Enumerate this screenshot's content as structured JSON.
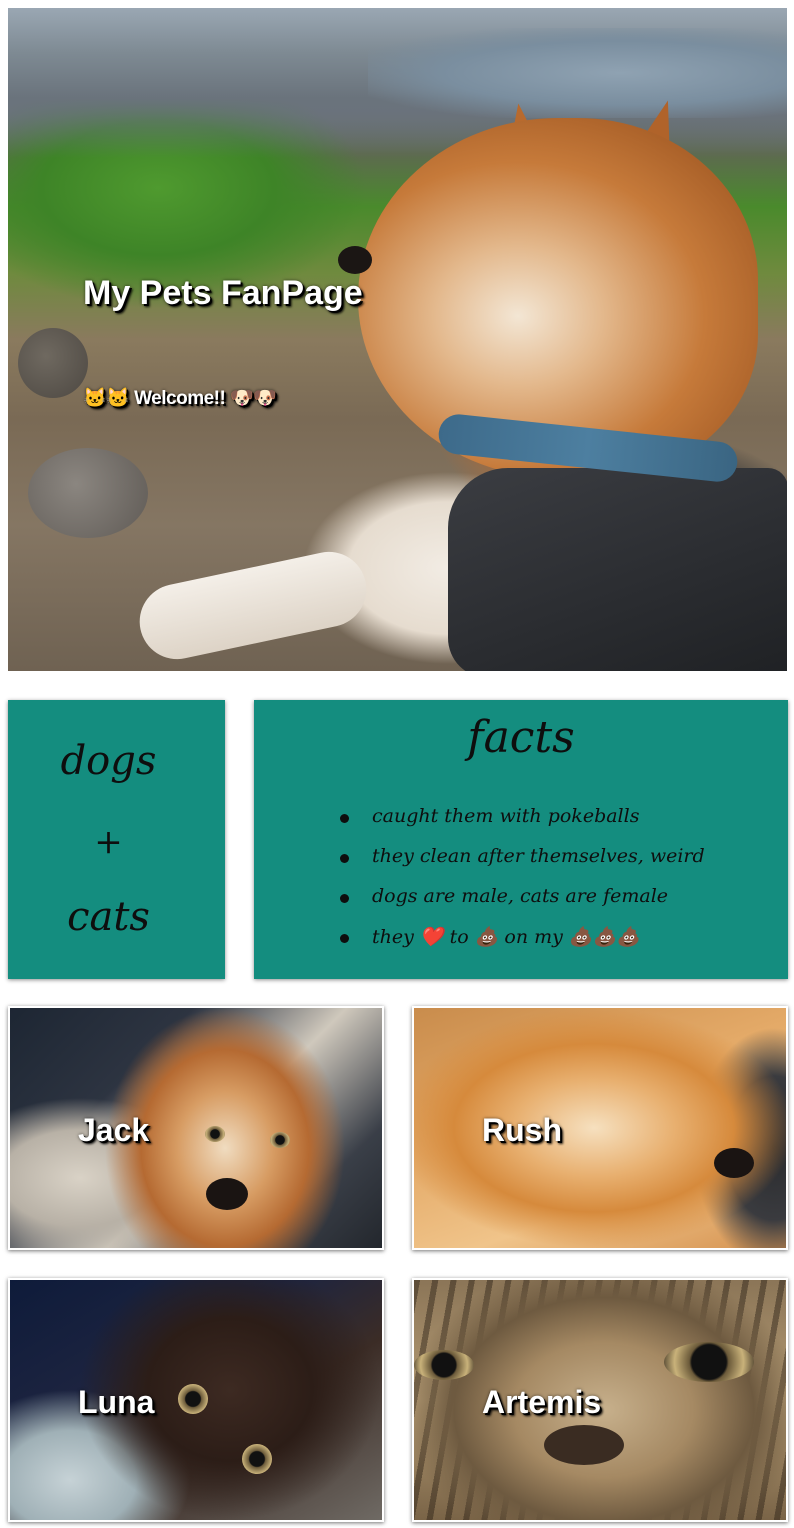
{
  "hero": {
    "title": "My Pets FanPage",
    "welcome": "🐱🐱 Welcome!! 🐶🐶"
  },
  "intro_card": {
    "line1": "dogs",
    "line2": "+",
    "line3": "cats"
  },
  "facts": {
    "heading": "facts",
    "items": [
      "caught them with pokeballs",
      "they clean after themselves, weird",
      "dogs are male, cats are female",
      "they ❤️ to 💩 on my 💩💩💩"
    ]
  },
  "pets": [
    {
      "name": "Jack"
    },
    {
      "name": "Rush"
    },
    {
      "name": "Luna"
    },
    {
      "name": "Artemis"
    }
  ],
  "colors": {
    "card_teal": "#148d7f",
    "text_white": "#ffffff",
    "text_dark": "#0e0e0e"
  }
}
